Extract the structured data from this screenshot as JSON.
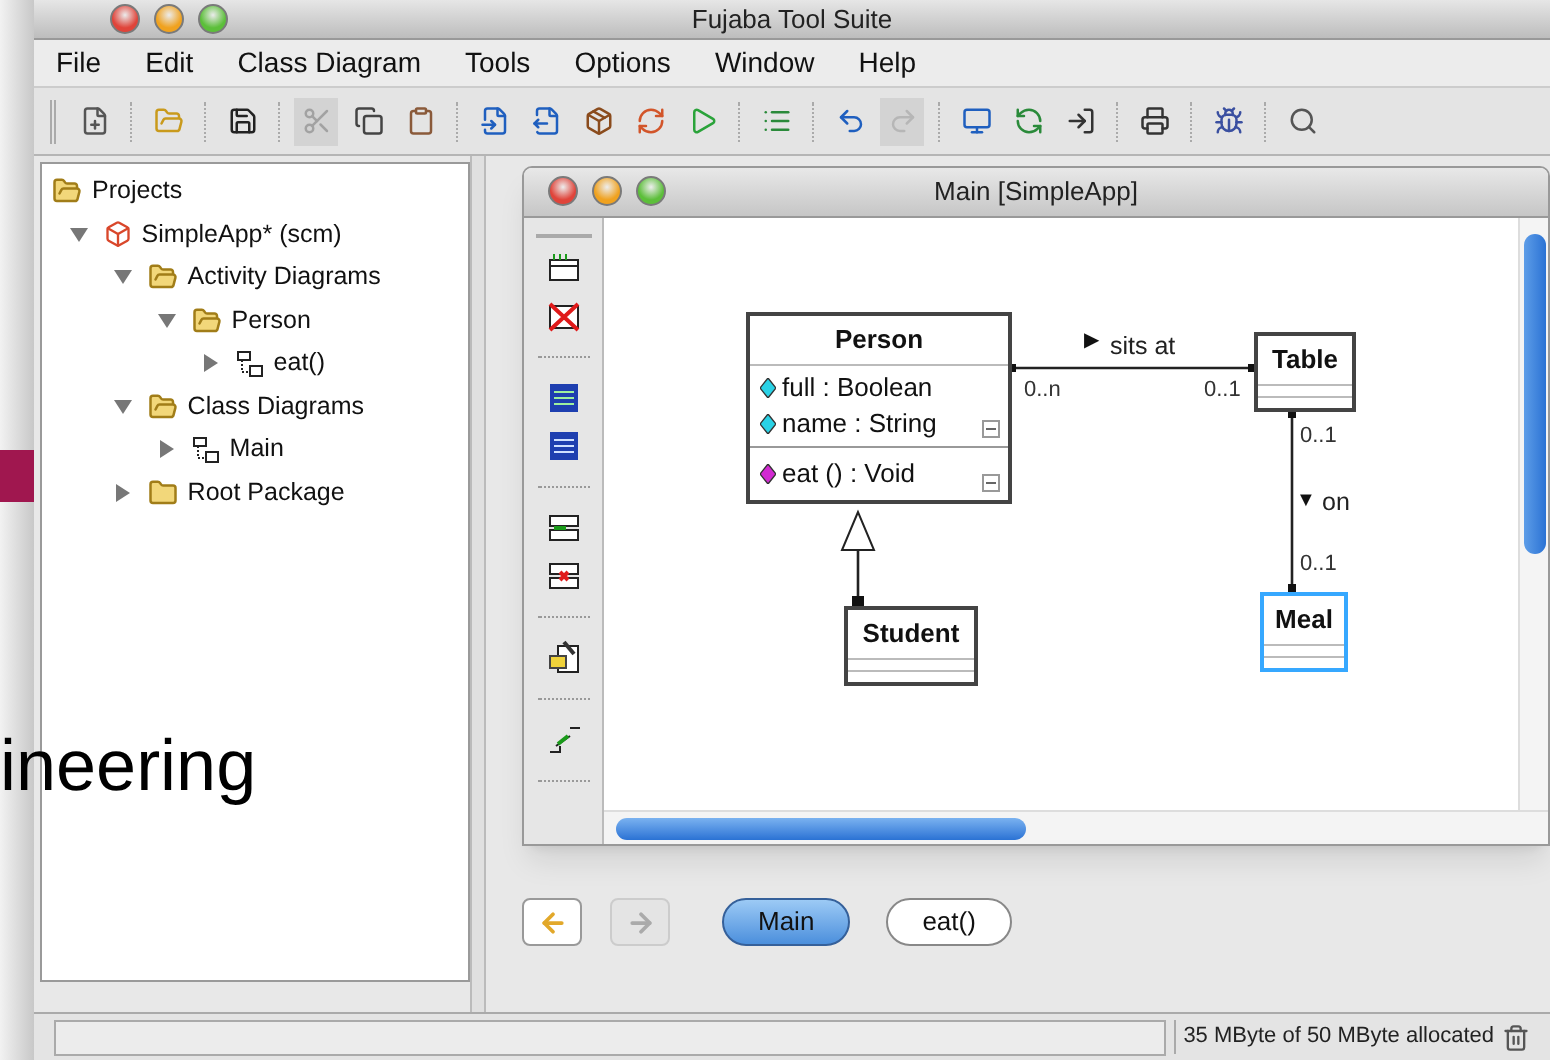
{
  "window": {
    "title": "Fujaba Tool Suite"
  },
  "menu": [
    "File",
    "Edit",
    "Class Diagram",
    "Tools",
    "Options",
    "Window",
    "Help"
  ],
  "toolbar": [
    {
      "kind": "new",
      "disabled": false
    },
    {
      "kind": "sep"
    },
    {
      "kind": "open",
      "disabled": false
    },
    {
      "kind": "sep"
    },
    {
      "kind": "save",
      "disabled": false
    },
    {
      "kind": "sep"
    },
    {
      "kind": "cut",
      "disabled": true
    },
    {
      "kind": "copy",
      "disabled": false
    },
    {
      "kind": "paste",
      "disabled": false
    },
    {
      "kind": "sep"
    },
    {
      "kind": "import",
      "disabled": false
    },
    {
      "kind": "export",
      "disabled": false
    },
    {
      "kind": "package",
      "disabled": false
    },
    {
      "kind": "refresh",
      "disabled": false
    },
    {
      "kind": "run",
      "disabled": false
    },
    {
      "kind": "sep"
    },
    {
      "kind": "list",
      "disabled": false
    },
    {
      "kind": "sep"
    },
    {
      "kind": "undo",
      "disabled": false
    },
    {
      "kind": "redo",
      "disabled": true
    },
    {
      "kind": "sep"
    },
    {
      "kind": "computer",
      "disabled": false
    },
    {
      "kind": "sync",
      "disabled": false
    },
    {
      "kind": "exit",
      "disabled": false
    },
    {
      "kind": "sep"
    },
    {
      "kind": "print",
      "disabled": false
    },
    {
      "kind": "sep"
    },
    {
      "kind": "debug",
      "disabled": false
    },
    {
      "kind": "sep"
    },
    {
      "kind": "zoom",
      "disabled": false
    }
  ],
  "tree": [
    {
      "label": "Projects",
      "kind": "folder-open",
      "children": [
        {
          "label": "SimpleApp* (scm)",
          "kind": "project",
          "expanded": true,
          "children": [
            {
              "label": "Activity Diagrams",
              "kind": "folder-open",
              "expanded": true,
              "children": [
                {
                  "label": "Person",
                  "kind": "folder-open",
                  "expanded": true,
                  "children": [
                    {
                      "label": "eat()",
                      "kind": "diagram",
                      "expanded": false
                    }
                  ]
                }
              ]
            },
            {
              "label": "Class Diagrams",
              "kind": "folder-open",
              "expanded": true,
              "children": [
                {
                  "label": "Main",
                  "kind": "diagram",
                  "expanded": false
                }
              ]
            },
            {
              "label": "Root Package",
              "kind": "folder",
              "expanded": false
            }
          ]
        }
      ]
    }
  ],
  "background_text": "ineering",
  "diagram_window": {
    "title": "Main [SimpleApp]",
    "classes": [
      {
        "name": "Person",
        "selected": false,
        "attributes": [
          "full : Boolean",
          "name : String"
        ],
        "methods": [
          "eat () : Void"
        ]
      },
      {
        "name": "Table",
        "selected": false
      },
      {
        "name": "Student",
        "selected": false
      },
      {
        "name": "Meal",
        "selected": true
      }
    ],
    "associations": [
      {
        "label": "sits at",
        "arrow": "▶",
        "source_multiplicity": "0..n",
        "target_multiplicity": "0..1"
      },
      {
        "label": "on",
        "arrow": "▼",
        "source_multiplicity": "0..1",
        "target_multiplicity": "0..1"
      }
    ]
  },
  "navigation": {
    "back_disabled": false,
    "forward_disabled": true,
    "tabs": [
      {
        "label": "Main",
        "selected": true
      },
      {
        "label": "eat()",
        "selected": false
      }
    ]
  },
  "status_bar": {
    "memory": "35 MByte of 50 MByte allocated"
  }
}
